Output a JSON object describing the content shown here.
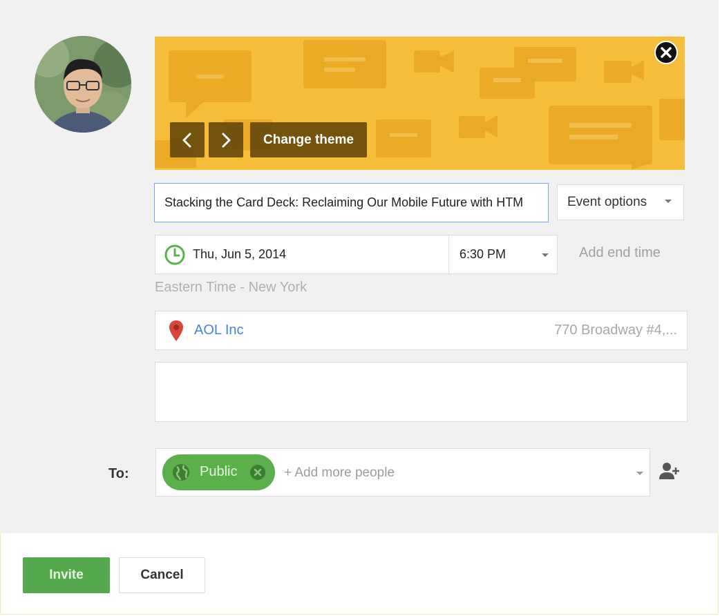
{
  "theme": {
    "prev_label": "‹",
    "next_label": "›",
    "change_theme_label": "Change theme",
    "background_color": "#f6bd3a",
    "close_icon": "close-circle-icon"
  },
  "event": {
    "title_value": "Stacking the Card Deck: Reclaiming Our Mobile Future with HTM",
    "options_label": "Event options",
    "date": "Thu, Jun 5, 2014",
    "date_icon": "clock-icon",
    "time": "6:30 PM",
    "add_end_time": "Add end time",
    "timezone": "Eastern Time - New York",
    "location_name": "AOL Inc",
    "location_address": "770 Broadway #4,...",
    "location_icon": "map-pin-icon",
    "description_value": ""
  },
  "invite": {
    "to_label": "To:",
    "chip_label": "Public",
    "chip_icon": "globe-icon",
    "add_people_placeholder": "+ Add more people",
    "add_person_icon": "add-person-icon"
  },
  "actions": {
    "invite_label": "Invite",
    "cancel_label": "Cancel"
  },
  "colors": {
    "accent_green": "#53a94b",
    "link_blue": "#4a7ee8",
    "pin_red": "#d9453b"
  }
}
